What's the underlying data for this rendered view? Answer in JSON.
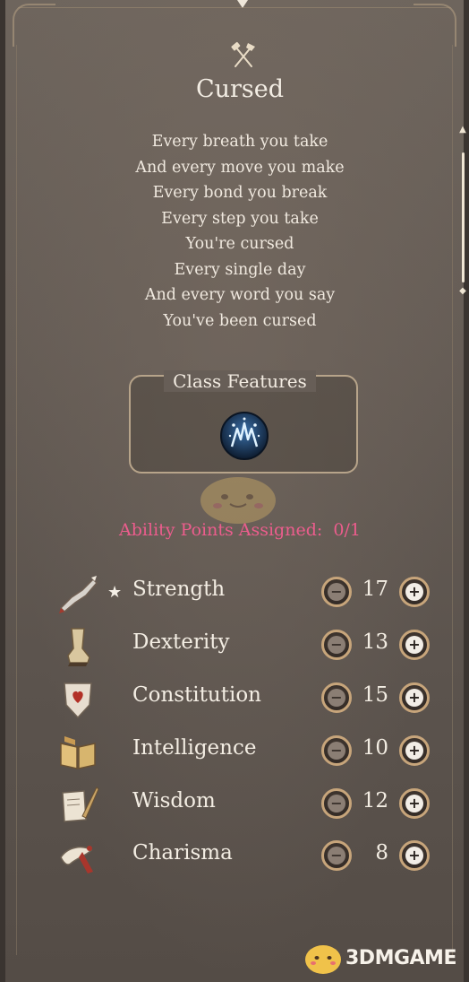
{
  "condition": {
    "title": "Cursed",
    "icon": "crossed-axe-hammer-icon",
    "description": [
      "Every breath you take",
      "And every move you make",
      "Every bond you break",
      "Every step you take",
      "You're cursed",
      "Every single day",
      "And every word you say",
      "You've been cursed"
    ]
  },
  "class_features": {
    "title": "Class Features",
    "icon": "lightning-rune-icon"
  },
  "ability_points": {
    "label": "Ability Points Assigned:",
    "value": "0/1",
    "color": "#ec5d8d"
  },
  "abilities": [
    {
      "name": "Strength",
      "value": "17",
      "icon": "armored-arm-icon",
      "primary": true
    },
    {
      "name": "Dexterity",
      "value": "13",
      "icon": "boot-icon",
      "primary": false
    },
    {
      "name": "Constitution",
      "value": "15",
      "icon": "shield-heart-icon",
      "primary": false
    },
    {
      "name": "Intelligence",
      "value": "10",
      "icon": "open-book-icon",
      "primary": false
    },
    {
      "name": "Wisdom",
      "value": "12",
      "icon": "scroll-quill-icon",
      "primary": false
    },
    {
      "name": "Charisma",
      "value": "8",
      "icon": "bird-feather-icon",
      "primary": false
    }
  ],
  "buttons": {
    "minus": "−",
    "plus": "+"
  },
  "watermark": {
    "text": "3DMGAME"
  },
  "colors": {
    "panel": "#665d56",
    "accent_gold": "#c7a57b",
    "text": "#f3ede3"
  }
}
